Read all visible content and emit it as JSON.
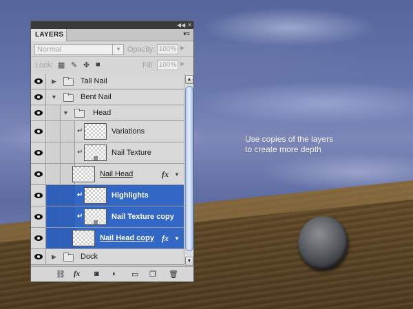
{
  "panel": {
    "tab_label": "LAYERS",
    "blend_mode": "Normal",
    "opacity_label": "Opacity:",
    "opacity_value": "100%",
    "lock_label": "Lock:",
    "fill_label": "Fill:",
    "fill_value": "100%"
  },
  "layers": [
    {
      "name": "Tall Nail",
      "type": "group",
      "expanded": false,
      "selected": false
    },
    {
      "name": "Bent Nail",
      "type": "group",
      "expanded": true,
      "selected": false
    },
    {
      "name": "Head",
      "type": "group",
      "expanded": true,
      "selected": false
    },
    {
      "name": "Variations",
      "type": "layer",
      "clipped": true,
      "selected": false
    },
    {
      "name": "Nail Texture",
      "type": "layer",
      "clipped": true,
      "selected": false
    },
    {
      "name": "Nail Head",
      "type": "layer",
      "fx": true,
      "selected": false
    },
    {
      "name": "Highlights",
      "type": "layer",
      "clipped": true,
      "selected": true
    },
    {
      "name": "Nail Texture copy",
      "type": "layer",
      "clipped": true,
      "selected": true
    },
    {
      "name": "Nail Head copy",
      "type": "layer",
      "fx": true,
      "selected": true
    },
    {
      "name": "Dock",
      "type": "group",
      "expanded": false,
      "selected": false
    }
  ],
  "fx_label": "fx",
  "note": {
    "line1": "Use copies of the layers",
    "line2": "to create more depth"
  },
  "icons": {
    "collapse": "double-chevron-icon",
    "close": "close-icon",
    "menu": "panel-menu-icon"
  },
  "colors": {
    "selection": "#3367c5",
    "panel_bg": "#d6d6d6"
  }
}
